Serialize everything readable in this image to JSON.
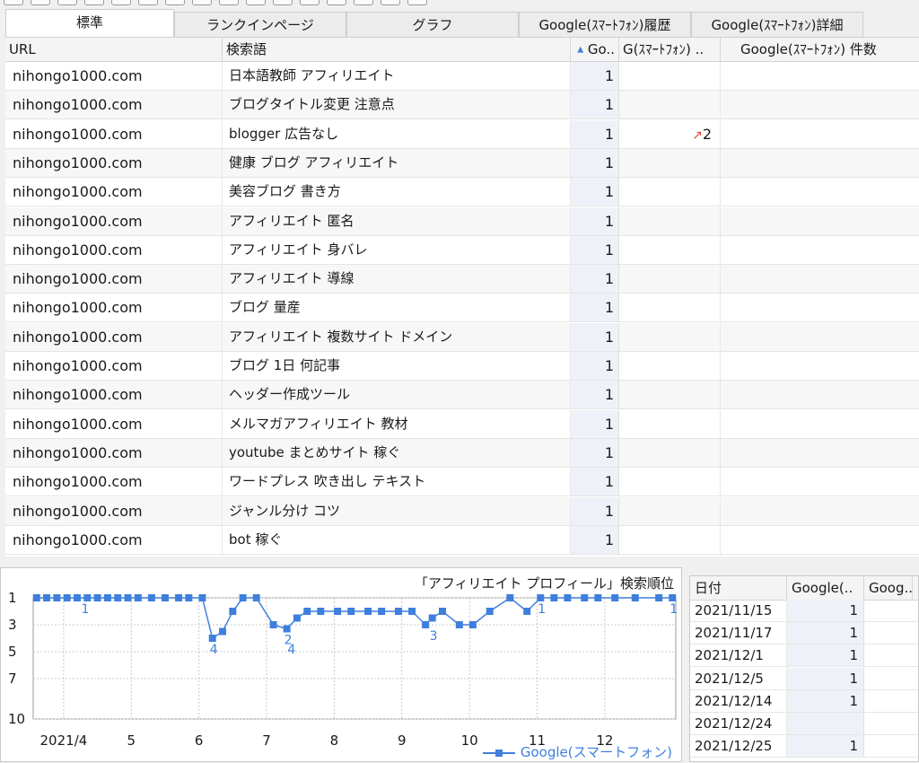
{
  "tabs": [
    "標準",
    "ランクインページ",
    "グラフ",
    "Google(ｽﾏｰﾄﾌｫﾝ)履歴",
    "Google(ｽﾏｰﾄﾌｫﾝ)詳細"
  ],
  "grid": {
    "headers": {
      "url": "URL",
      "keyword": "検索語",
      "sort_icon": "sort-ascending-icon",
      "rank": "Go..",
      "google_sp": "G(ｽﾏｰﾄﾌｫﾝ) ..",
      "count": "Google(ｽﾏｰﾄﾌｫﾝ) 件数"
    },
    "rows": [
      {
        "url": "nihongo1000.com",
        "keyword": "日本語教師 アフィリエイト",
        "rank": "1",
        "google_sp": ""
      },
      {
        "url": "nihongo1000.com",
        "keyword": "ブログタイトル変更 注意点",
        "rank": "1",
        "google_sp": ""
      },
      {
        "url": "nihongo1000.com",
        "keyword": "blogger 広告なし",
        "rank": "1",
        "google_sp": "2",
        "trend": "up-arrow-icon"
      },
      {
        "url": "nihongo1000.com",
        "keyword": "健康 ブログ アフィリエイト",
        "rank": "1",
        "google_sp": ""
      },
      {
        "url": "nihongo1000.com",
        "keyword": "美容ブログ 書き方",
        "rank": "1",
        "google_sp": ""
      },
      {
        "url": "nihongo1000.com",
        "keyword": "アフィリエイト 匿名",
        "rank": "1",
        "google_sp": ""
      },
      {
        "url": "nihongo1000.com",
        "keyword": "アフィリエイト 身バレ",
        "rank": "1",
        "google_sp": ""
      },
      {
        "url": "nihongo1000.com",
        "keyword": "アフィリエイト 導線",
        "rank": "1",
        "google_sp": ""
      },
      {
        "url": "nihongo1000.com",
        "keyword": "ブログ 量産",
        "rank": "1",
        "google_sp": ""
      },
      {
        "url": "nihongo1000.com",
        "keyword": "アフィリエイト 複数サイト ドメイン",
        "rank": "1",
        "google_sp": ""
      },
      {
        "url": "nihongo1000.com",
        "keyword": "ブログ 1日 何記事",
        "rank": "1",
        "google_sp": ""
      },
      {
        "url": "nihongo1000.com",
        "keyword": "ヘッダー作成ツール",
        "rank": "1",
        "google_sp": ""
      },
      {
        "url": "nihongo1000.com",
        "keyword": "メルマガアフィリエイト 教材",
        "rank": "1",
        "google_sp": ""
      },
      {
        "url": "nihongo1000.com",
        "keyword": "youtube まとめサイト 稼ぐ",
        "rank": "1",
        "google_sp": ""
      },
      {
        "url": "nihongo1000.com",
        "keyword": "ワードプレス 吹き出し テキスト",
        "rank": "1",
        "google_sp": ""
      },
      {
        "url": "nihongo1000.com",
        "keyword": "ジャンル分け コツ",
        "rank": "1",
        "google_sp": ""
      },
      {
        "url": "nihongo1000.com",
        "keyword": "bot 稼ぐ",
        "rank": "1",
        "google_sp": ""
      }
    ]
  },
  "chart_data": {
    "type": "line",
    "title": "「アフィリエイト プロフィール」検索順位",
    "xlabel": "",
    "ylabel": "",
    "y_reversed": true,
    "ylim": [
      1,
      10
    ],
    "y_ticks": [
      "1",
      "3",
      "5",
      "7",
      "10"
    ],
    "x_ticks": [
      "2021/4",
      "5",
      "6",
      "7",
      "8",
      "9",
      "10",
      "11",
      "12"
    ],
    "x_tick_months": [
      4,
      5,
      6,
      7,
      8,
      9,
      10,
      11,
      12
    ],
    "xlim": [
      3.55,
      13.05
    ],
    "grid": true,
    "legend_position": "bottom-right",
    "series": [
      {
        "name": "Google(スマートフォン)",
        "color": "#3f7fdc",
        "points": [
          [
            3.6,
            1
          ],
          [
            3.75,
            1
          ],
          [
            3.9,
            1
          ],
          [
            4.05,
            1
          ],
          [
            4.2,
            1
          ],
          [
            4.35,
            1
          ],
          [
            4.5,
            1
          ],
          [
            4.65,
            1
          ],
          [
            4.8,
            1
          ],
          [
            4.95,
            1
          ],
          [
            5.1,
            1
          ],
          [
            5.3,
            1
          ],
          [
            5.5,
            1
          ],
          [
            5.7,
            1
          ],
          [
            5.85,
            1
          ],
          [
            6.05,
            1
          ],
          [
            6.2,
            4
          ],
          [
            6.35,
            3.5
          ],
          [
            6.5,
            2
          ],
          [
            6.65,
            1
          ],
          [
            6.85,
            1
          ],
          [
            7.1,
            3
          ],
          [
            7.3,
            3.3
          ],
          [
            7.45,
            2.5
          ],
          [
            7.6,
            2
          ],
          [
            7.8,
            2
          ],
          [
            8.05,
            2
          ],
          [
            8.25,
            2
          ],
          [
            8.5,
            2
          ],
          [
            8.7,
            2
          ],
          [
            8.95,
            2
          ],
          [
            9.15,
            2
          ],
          [
            9.35,
            3
          ],
          [
            9.45,
            2.5
          ],
          [
            9.6,
            2
          ],
          [
            9.85,
            3
          ],
          [
            10.05,
            3
          ],
          [
            10.3,
            2
          ],
          [
            10.6,
            1
          ],
          [
            10.85,
            2
          ],
          [
            11.05,
            1
          ],
          [
            11.25,
            1
          ],
          [
            11.45,
            1
          ],
          [
            11.7,
            1
          ],
          [
            11.9,
            1
          ],
          [
            12.15,
            1
          ],
          [
            12.45,
            1
          ],
          [
            12.8,
            1
          ],
          [
            13.0,
            1
          ]
        ],
        "point_labels": [
          {
            "x": 4.3,
            "y": 1,
            "text": "1"
          },
          {
            "x": 6.2,
            "y": 4,
            "text": "4"
          },
          {
            "x": 7.3,
            "y": 3.3,
            "text": "2"
          },
          {
            "x": 7.35,
            "y": 4,
            "text": "4"
          },
          {
            "x": 9.45,
            "y": 3,
            "text": "3"
          },
          {
            "x": 11.05,
            "y": 1,
            "text": "1"
          },
          {
            "x": 13.0,
            "y": 1,
            "text": "1"
          }
        ]
      }
    ]
  },
  "date_table": {
    "headers": [
      "日付",
      "Google(..",
      "Goog.."
    ],
    "rows": [
      {
        "date": "2021/11/15",
        "v1": "1",
        "v2": ""
      },
      {
        "date": "2021/11/17",
        "v1": "1",
        "v2": ""
      },
      {
        "date": "2021/12/1",
        "v1": "1",
        "v2": ""
      },
      {
        "date": "2021/12/5",
        "v1": "1",
        "v2": ""
      },
      {
        "date": "2021/12/14",
        "v1": "1",
        "v2": ""
      },
      {
        "date": "2021/12/24",
        "v1": "",
        "v2": ""
      },
      {
        "date": "2021/12/25",
        "v1": "1",
        "v2": ""
      }
    ]
  }
}
